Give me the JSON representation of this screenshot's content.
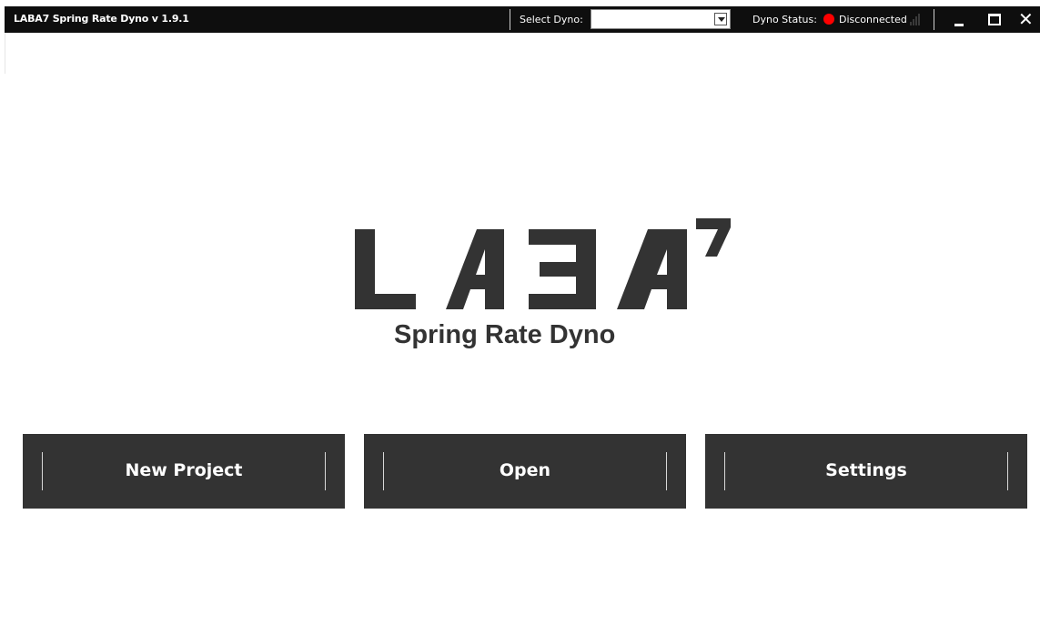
{
  "titlebar": {
    "app_title": "LABA7 Spring Rate Dyno  v 1.9.1",
    "select_label": "Select Dyno:",
    "select_value": "",
    "status_label": "Dyno Status:",
    "status_value": "Disconnected",
    "status_color": "#ff0000",
    "icons": [
      "dropdown-arrow-icon",
      "status-dot-icon",
      "signal-strength-icon",
      "minimize-icon",
      "maximize-icon",
      "close-icon"
    ]
  },
  "logo": {
    "brand": "LABA7",
    "subtitle": "Spring Rate Dyno"
  },
  "actions": {
    "new_project": "New Project",
    "open": "Open",
    "settings": "Settings"
  },
  "colors": {
    "titlebar_bg": "#0e0e0e",
    "button_bg": "#333333",
    "logo": "#333333"
  }
}
